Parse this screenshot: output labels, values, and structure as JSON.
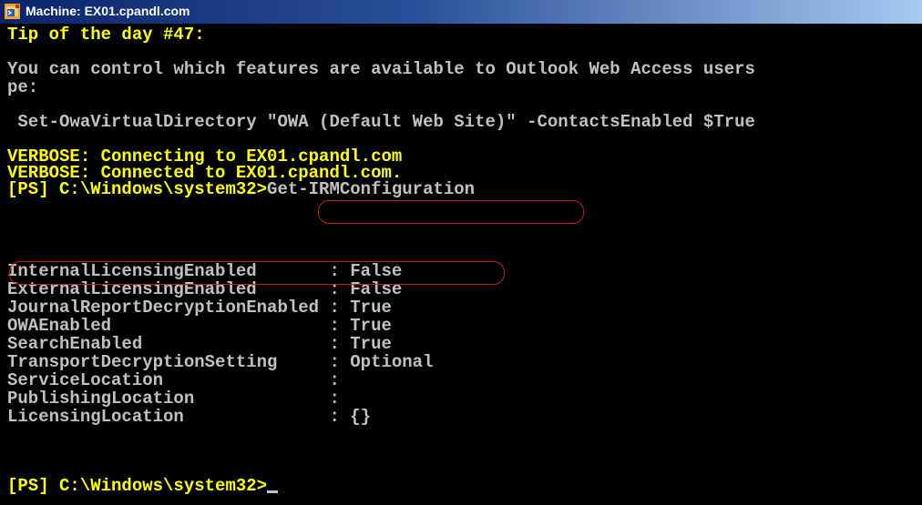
{
  "window": {
    "title": "Machine: EX01.cpandl.com",
    "icon": "powershell-console-icon"
  },
  "console": {
    "tip_heading": "Tip of the day #47:",
    "tip_text_1": "You can control which features are available to Outlook Web Access users",
    "tip_text_2": "pe:",
    "tip_command": " Set-OwaVirtualDirectory \"OWA (Default Web Site)\" -ContactsEnabled $True",
    "verbose_1": "VERBOSE: Connecting to EX01.cpandl.com",
    "verbose_2": "VERBOSE: Connected to EX01.cpandl.com.",
    "prompt_1": "[PS] C:\\Windows\\system32>",
    "command_1": "Get-IRMConfiguration",
    "properties": [
      {
        "name": "InternalLicensingEnabled       ",
        "value": ": False"
      },
      {
        "name": "ExternalLicensingEnabled       ",
        "value": ": False"
      },
      {
        "name": "JournalReportDecryptionEnabled ",
        "value": ": True"
      },
      {
        "name": "OWAEnabled                     ",
        "value": ": True"
      },
      {
        "name": "SearchEnabled                  ",
        "value": ": True"
      },
      {
        "name": "TransportDecryptionSetting     ",
        "value": ": Optional"
      },
      {
        "name": "ServiceLocation                ",
        "value": ":"
      },
      {
        "name": "PublishingLocation             ",
        "value": ":"
      },
      {
        "name": "LicensingLocation              ",
        "value": ": {}"
      }
    ],
    "prompt_2": "[PS] C:\\Windows\\system32>"
  },
  "colors": {
    "background": "#000000",
    "prompt_text": "#ffff00",
    "output_text": "#c0c0c0",
    "highlight_mark": "#c41e1e"
  }
}
